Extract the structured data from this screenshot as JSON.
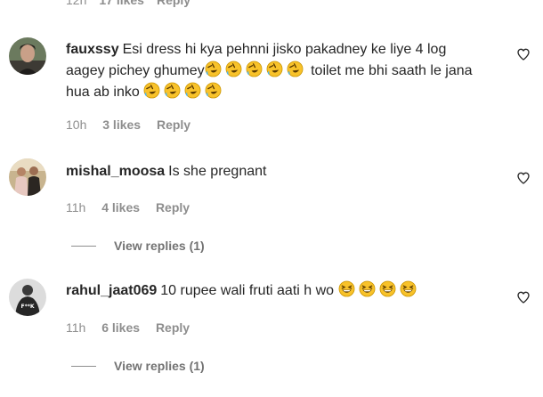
{
  "partial_top": {
    "time": "12h",
    "likes": "17 likes",
    "reply": "Reply"
  },
  "comments": [
    {
      "username": "fauxssy",
      "text_line1": "Esi dress hi kya pehnni jisko pakadney ke liye 4 log",
      "text_line2a": "aagey pichey ghumey",
      "text_line2b": " toilet me bhi saath le jana",
      "text_line3": "hua ab inko",
      "time": "10h",
      "likes": "3 likes",
      "reply": "Reply"
    },
    {
      "username": "mishal_moosa",
      "text": "Is she pregnant",
      "time": "11h",
      "likes": "4 likes",
      "reply": "Reply",
      "view_replies": "View replies (1)"
    },
    {
      "username": "rahul_jaat069",
      "text": "10 rupee wali fruti aati h wo",
      "time": "11h",
      "likes": "6 likes",
      "reply": "Reply",
      "view_replies": "View replies (1)"
    }
  ],
  "icons": {
    "heart": "heart-outline-icon",
    "laugh_emoji": "rolling-on-floor-laughing-emoji",
    "grin_emoji": "grinning-squinting-emoji"
  },
  "colors": {
    "text": "#262626",
    "secondary": "#8e8e8e",
    "emoji_yellow": "#f8c22a"
  }
}
